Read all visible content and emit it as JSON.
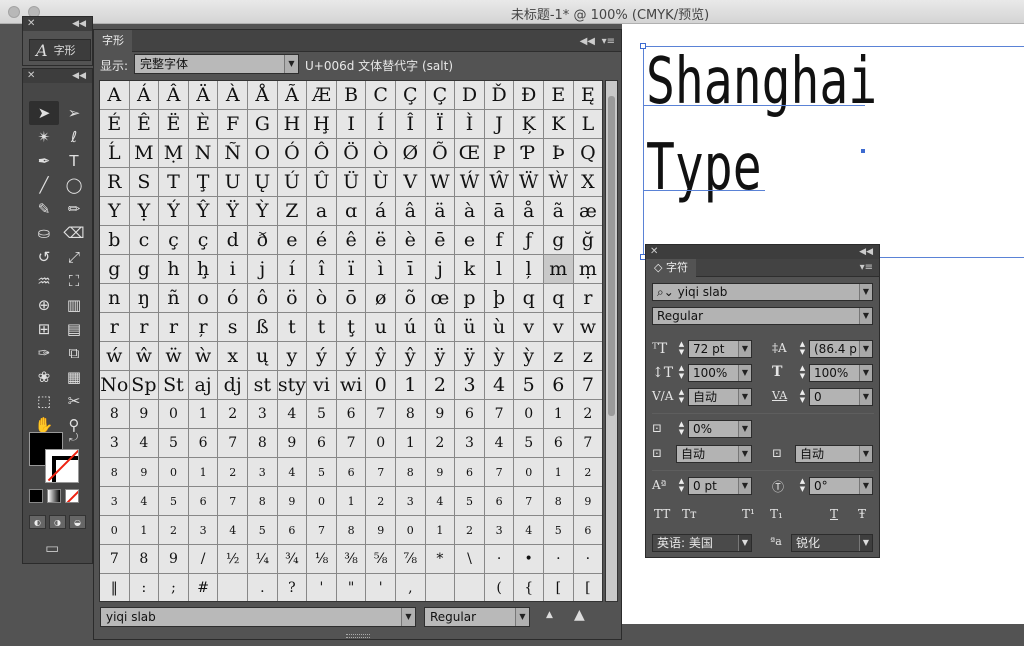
{
  "window": {
    "title": "未标题-1* @ 100% (CMYK/预览)"
  },
  "glyph_mini": {
    "label": "字形",
    "icon": "type-glyph-icon"
  },
  "toolbar": {
    "tools": [
      {
        "name": "selection-tool-icon",
        "glyph": "➤"
      },
      {
        "name": "direct-selection-tool-icon",
        "glyph": "➢"
      },
      {
        "name": "magic-wand-tool-icon",
        "glyph": "✴"
      },
      {
        "name": "lasso-tool-icon",
        "glyph": "ℓ"
      },
      {
        "name": "pen-tool-icon",
        "glyph": "✒"
      },
      {
        "name": "type-tool-icon",
        "glyph": "T"
      },
      {
        "name": "line-tool-icon",
        "glyph": "╱"
      },
      {
        "name": "ellipse-tool-icon",
        "glyph": "◯"
      },
      {
        "name": "paintbrush-tool-icon",
        "glyph": "✎"
      },
      {
        "name": "pencil-tool-icon",
        "glyph": "✏"
      },
      {
        "name": "blob-brush-tool-icon",
        "glyph": "⛀"
      },
      {
        "name": "eraser-tool-icon",
        "glyph": "⌫"
      },
      {
        "name": "rotate-tool-icon",
        "glyph": "↺"
      },
      {
        "name": "scale-tool-icon",
        "glyph": "⤢"
      },
      {
        "name": "warp-tool-icon",
        "glyph": "♒"
      },
      {
        "name": "free-transform-tool-icon",
        "glyph": "⛶"
      },
      {
        "name": "shape-builder-tool-icon",
        "glyph": "⊕"
      },
      {
        "name": "graph-tool-icon",
        "glyph": "▥"
      },
      {
        "name": "mesh-tool-icon",
        "glyph": "⊞"
      },
      {
        "name": "gradient-tool-icon",
        "glyph": "▤"
      },
      {
        "name": "eyedropper-tool-icon",
        "glyph": "✑"
      },
      {
        "name": "blend-tool-icon",
        "glyph": "⧉"
      },
      {
        "name": "symbol-sprayer-tool-icon",
        "glyph": "❀"
      },
      {
        "name": "column-graph-tool-icon",
        "glyph": "▦"
      },
      {
        "name": "artboard-tool-icon",
        "glyph": "⬚"
      },
      {
        "name": "slice-tool-icon",
        "glyph": "✂"
      },
      {
        "name": "hand-tool-icon",
        "glyph": "✋"
      },
      {
        "name": "zoom-tool-icon",
        "glyph": "⚲"
      }
    ]
  },
  "glyphs_panel": {
    "tab": "字形",
    "show_label": "显示:",
    "show_value": "完整字体",
    "unicode_info": "U+006d 文体替代字 (salt)",
    "font_family": "yiqi slab",
    "font_style": "Regular",
    "rows": [
      [
        "A",
        "Á",
        "Â",
        "Ä",
        "À",
        "Å",
        "Ã",
        "Æ",
        "B",
        "C",
        "Ç",
        "Ç",
        "D",
        "Ď",
        "Đ",
        "E",
        "Ę"
      ],
      [
        "É",
        "Ê",
        "Ë",
        "È",
        "F",
        "G",
        "H",
        "Ḩ",
        "I",
        "Í",
        "Î",
        "Ï",
        "Ì",
        "J",
        "Ķ",
        "K",
        "L"
      ],
      [
        "Ĺ",
        "M",
        "Ṃ",
        "N",
        "Ñ",
        "O",
        "Ó",
        "Ô",
        "Ö",
        "Ò",
        "Ø",
        "Õ",
        "Œ",
        "P",
        "Ƥ",
        "Þ",
        "Q"
      ],
      [
        "R",
        "S",
        "T",
        "Ţ",
        "U",
        "Ų",
        "Ú",
        "Û",
        "Ü",
        "Ù",
        "V",
        "W",
        "Ẃ",
        "Ŵ",
        "Ẅ",
        "Ẁ",
        "X"
      ],
      [
        "Y",
        "Ỵ",
        "Ý",
        "Ŷ",
        "Ÿ",
        "Ỳ",
        "Z",
        "a",
        "ɑ",
        "á",
        "â",
        "ä",
        "à",
        "ā",
        "å",
        "ã",
        "æ"
      ],
      [
        "b",
        "c",
        "ç",
        "ç",
        "d",
        "ð",
        "e",
        "é",
        "ê",
        "ë",
        "è",
        "ē",
        "e",
        "f",
        "ƒ",
        "g",
        "ğ"
      ],
      [
        "g",
        "g",
        "h",
        "ḩ",
        "i",
        "j",
        "í",
        "î",
        "ï",
        "ì",
        "ī",
        "j",
        "k",
        "l",
        "ļ",
        "m",
        "ṃ"
      ],
      [
        "n",
        "ŋ",
        "ñ",
        "o",
        "ó",
        "ô",
        "ö",
        "ò",
        "ō",
        "ø",
        "õ",
        "œ",
        "p",
        "þ",
        "q",
        "q",
        "r"
      ],
      [
        "r",
        "r",
        "r",
        "ŗ",
        "s",
        "ß",
        "t",
        "t",
        "ţ",
        "u",
        "ú",
        "û",
        "ü",
        "ù",
        "v",
        "v",
        "w"
      ],
      [
        "ẃ",
        "ŵ",
        "ẅ",
        "ẁ",
        "x",
        "ų",
        "y",
        "ý",
        "ý",
        "ŷ",
        "ŷ",
        "ÿ",
        "ÿ",
        "ỳ",
        "ỳ",
        "z",
        "z"
      ],
      [
        "No",
        "Sp",
        "St",
        "aj",
        "dj",
        "st",
        "sty",
        "vi",
        "wi",
        "0",
        "1",
        "2",
        "3",
        "4",
        "5",
        "6",
        "7"
      ],
      [
        "8",
        "9",
        "0",
        "1",
        "2",
        "3",
        "4",
        "5",
        "6",
        "7",
        "8",
        "9",
        "6",
        "7",
        "0",
        "1",
        "2"
      ],
      [
        "3",
        "4",
        "5",
        "6",
        "7",
        "8",
        "9",
        "6",
        "7",
        "0",
        "1",
        "2",
        "3",
        "4",
        "5",
        "6",
        "7"
      ],
      [
        "8",
        "9",
        "0",
        "1",
        "2",
        "3",
        "4",
        "5",
        "6",
        "7",
        "8",
        "9",
        "6",
        "7",
        "0",
        "1",
        "2"
      ],
      [
        "3",
        "4",
        "5",
        "6",
        "7",
        "8",
        "9",
        "0",
        "1",
        "2",
        "3",
        "4",
        "5",
        "6",
        "7",
        "8",
        "9"
      ],
      [
        "0",
        "1",
        "2",
        "3",
        "4",
        "5",
        "6",
        "7",
        "8",
        "9",
        "0",
        "1",
        "2",
        "3",
        "4",
        "5",
        "6"
      ],
      [
        "7",
        "8",
        "9",
        "/",
        "½",
        "¼",
        "¾",
        "⅛",
        "⅜",
        "⅝",
        "⅞",
        "*",
        "\\",
        "·",
        "•",
        "·",
        "·"
      ],
      [
        "‖",
        ":",
        ";",
        "#",
        "",
        ".",
        "?",
        "'",
        "\"",
        "'",
        ",",
        "",
        "",
        "(",
        "{",
        "[",
        "["
      ]
    ]
  },
  "artboard": {
    "line1": "Shanghai",
    "line2": "Type"
  },
  "character_panel": {
    "tab": "字符",
    "font_family": "yiqi slab",
    "font_style": "Regular",
    "font_size": "72 pt",
    "leading": "(86.4 p",
    "vertical_scale": "100%",
    "horizontal_scale": "100%",
    "kerning": "自动",
    "tracking": "0",
    "tsume": "0%",
    "aki_left": "自动",
    "aki_right": "自动",
    "baseline_shift": "0 pt",
    "rotation": "0°",
    "language": "英语: 美国",
    "anti_alias": "锐化",
    "styles": [
      "TT",
      "Tᴛ",
      "T¹",
      "T₁",
      "T",
      "Ŧ"
    ]
  }
}
